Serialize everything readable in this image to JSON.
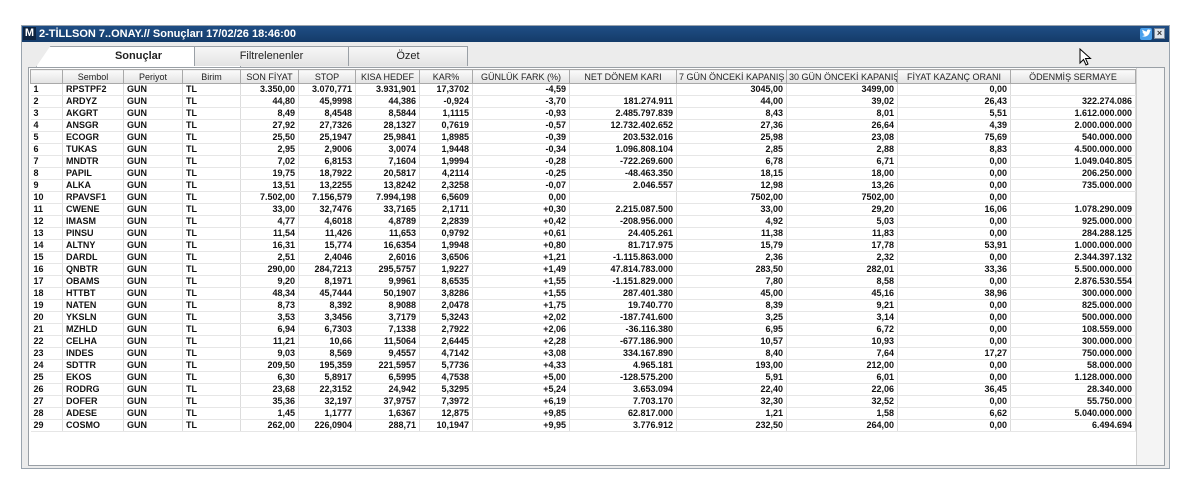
{
  "window": {
    "app_letter": "M",
    "title": "2-TİLLSON 7..ONAY.// Sonuçları  17/02/26 18:46:00"
  },
  "tabs": [
    {
      "label": "Sonuçlar"
    },
    {
      "label": "Filtrelenenler"
    },
    {
      "label": "Özet"
    }
  ],
  "icons": {
    "twitter": "twitter-icon",
    "close": "close-icon",
    "cursor": "mouse-cursor-icon"
  },
  "colors": {
    "titlebar": "#1f4e85",
    "twitter": "#4aa0ec"
  },
  "table": {
    "headers": [
      "",
      "Sembol",
      "Periyot",
      "Birim",
      "SON FİYAT",
      "STOP",
      "KISA HEDEF",
      "KAR%",
      "GÜNLÜK FARK (%)",
      "NET DÖNEM KARI",
      "7 GÜN ÖNCEKİ KAPANIŞ",
      "30 GÜN ÖNCEKİ KAPANIŞ",
      "FİYAT KAZANÇ ORANI",
      "ÖDENMİŞ SERMAYE"
    ],
    "rows": [
      [
        "1",
        "RPSTPF2",
        "GUN",
        "TL",
        "3.350,00",
        "3.070,771",
        "3.931,901",
        "17,3702",
        "-4,59",
        "",
        "3045,00",
        "3499,00",
        "0,00",
        ""
      ],
      [
        "2",
        "ARDYZ",
        "GUN",
        "TL",
        "44,80",
        "45,9998",
        "44,386",
        "-0,924",
        "-3,70",
        "181.274.911",
        "44,00",
        "39,02",
        "26,43",
        "322.274.086"
      ],
      [
        "3",
        "AKGRT",
        "GUN",
        "TL",
        "8,49",
        "8,4548",
        "8,5844",
        "1,1115",
        "-0,93",
        "2.485.797.839",
        "8,43",
        "8,01",
        "5,51",
        "1.612.000.000"
      ],
      [
        "4",
        "ANSGR",
        "GUN",
        "TL",
        "27,92",
        "27,7326",
        "28,1327",
        "0,7619",
        "-0,57",
        "12.732.402.652",
        "27,36",
        "26,64",
        "4,39",
        "2.000.000.000"
      ],
      [
        "5",
        "ECOGR",
        "GUN",
        "TL",
        "25,50",
        "25,1947",
        "25,9841",
        "1,8985",
        "-0,39",
        "203.532.016",
        "25,98",
        "23,08",
        "75,69",
        "540.000.000"
      ],
      [
        "6",
        "TUKAS",
        "GUN",
        "TL",
        "2,95",
        "2,9006",
        "3,0074",
        "1,9448",
        "-0,34",
        "1.096.808.104",
        "2,85",
        "2,88",
        "8,83",
        "4.500.000.000"
      ],
      [
        "7",
        "MNDTR",
        "GUN",
        "TL",
        "7,02",
        "6,8153",
        "7,1604",
        "1,9994",
        "-0,28",
        "-722.269.600",
        "6,78",
        "6,71",
        "0,00",
        "1.049.040.805"
      ],
      [
        "8",
        "PAPIL",
        "GUN",
        "TL",
        "19,75",
        "18,7922",
        "20,5817",
        "4,2114",
        "-0,25",
        "-48.463.350",
        "18,15",
        "18,00",
        "0,00",
        "206.250.000"
      ],
      [
        "9",
        "ALKA",
        "GUN",
        "TL",
        "13,51",
        "13,2255",
        "13,8242",
        "2,3258",
        "-0,07",
        "2.046.557",
        "12,98",
        "13,26",
        "0,00",
        "735.000.000"
      ],
      [
        "10",
        "RPAVSF1",
        "GUN",
        "TL",
        "7.502,00",
        "7.156,579",
        "7.994,198",
        "6,5609",
        "0,00",
        "",
        "7502,00",
        "7502,00",
        "0,00",
        ""
      ],
      [
        "11",
        "CWENE",
        "GUN",
        "TL",
        "33,00",
        "32,7476",
        "33,7165",
        "2,1711",
        "+0,30",
        "2.215.087.500",
        "33,00",
        "29,20",
        "16,06",
        "1.078.290.009"
      ],
      [
        "12",
        "IMASM",
        "GUN",
        "TL",
        "4,77",
        "4,6018",
        "4,8789",
        "2,2839",
        "+0,42",
        "-208.956.000",
        "4,92",
        "5,03",
        "0,00",
        "925.000.000"
      ],
      [
        "13",
        "PINSU",
        "GUN",
        "TL",
        "11,54",
        "11,426",
        "11,653",
        "0,9792",
        "+0,61",
        "24.405.261",
        "11,38",
        "11,83",
        "0,00",
        "284.288.125"
      ],
      [
        "14",
        "ALTNY",
        "GUN",
        "TL",
        "16,31",
        "15,774",
        "16,6354",
        "1,9948",
        "+0,80",
        "81.717.975",
        "15,79",
        "17,78",
        "53,91",
        "1.000.000.000"
      ],
      [
        "15",
        "DARDL",
        "GUN",
        "TL",
        "2,51",
        "2,4046",
        "2,6016",
        "3,6506",
        "+1,21",
        "-1.115.863.000",
        "2,36",
        "2,32",
        "0,00",
        "2.344.397.132"
      ],
      [
        "16",
        "QNBTR",
        "GUN",
        "TL",
        "290,00",
        "284,7213",
        "295,5757",
        "1,9227",
        "+1,49",
        "47.814.783.000",
        "283,50",
        "282,01",
        "33,36",
        "5.500.000.000"
      ],
      [
        "17",
        "OBAMS",
        "GUN",
        "TL",
        "9,20",
        "8,1971",
        "9,9961",
        "8,6535",
        "+1,55",
        "-1.151.829.000",
        "7,80",
        "8,58",
        "0,00",
        "2.876.530.554"
      ],
      [
        "18",
        "HTTBT",
        "GUN",
        "TL",
        "48,34",
        "45,7444",
        "50,1907",
        "3,8286",
        "+1,55",
        "287.401.380",
        "45,00",
        "45,16",
        "38,96",
        "300.000.000"
      ],
      [
        "19",
        "NATEN",
        "GUN",
        "TL",
        "8,73",
        "8,392",
        "8,9088",
        "2,0478",
        "+1,75",
        "19.740.770",
        "8,39",
        "9,21",
        "0,00",
        "825.000.000"
      ],
      [
        "20",
        "YKSLN",
        "GUN",
        "TL",
        "3,53",
        "3,3456",
        "3,7179",
        "5,3243",
        "+2,02",
        "-187.741.600",
        "3,25",
        "3,14",
        "0,00",
        "500.000.000"
      ],
      [
        "21",
        "MZHLD",
        "GUN",
        "TL",
        "6,94",
        "6,7303",
        "7,1338",
        "2,7922",
        "+2,06",
        "-36.116.380",
        "6,95",
        "6,72",
        "0,00",
        "108.559.000"
      ],
      [
        "22",
        "CELHA",
        "GUN",
        "TL",
        "11,21",
        "10,66",
        "11,5064",
        "2,6445",
        "+2,28",
        "-677.186.900",
        "10,57",
        "10,93",
        "0,00",
        "300.000.000"
      ],
      [
        "23",
        "INDES",
        "GUN",
        "TL",
        "9,03",
        "8,569",
        "9,4557",
        "4,7142",
        "+3,08",
        "334.167.890",
        "8,40",
        "7,64",
        "17,27",
        "750.000.000"
      ],
      [
        "24",
        "SDTTR",
        "GUN",
        "TL",
        "209,50",
        "195,359",
        "221,5957",
        "5,7736",
        "+4,33",
        "4.965.181",
        "193,00",
        "212,00",
        "0,00",
        "58.000.000"
      ],
      [
        "25",
        "EKOS",
        "GUN",
        "TL",
        "6,30",
        "5,8917",
        "6,5995",
        "4,7538",
        "+5,00",
        "-128.575.200",
        "5,91",
        "6,01",
        "0,00",
        "1.128.000.000"
      ],
      [
        "26",
        "RODRG",
        "GUN",
        "TL",
        "23,68",
        "22,3152",
        "24,942",
        "5,3295",
        "+5,24",
        "3.653.094",
        "22,40",
        "22,06",
        "36,45",
        "28.340.000"
      ],
      [
        "27",
        "DOFER",
        "GUN",
        "TL",
        "35,36",
        "32,197",
        "37,9757",
        "7,3972",
        "+6,19",
        "7.703.170",
        "32,30",
        "32,52",
        "0,00",
        "55.750.000"
      ],
      [
        "28",
        "ADESE",
        "GUN",
        "TL",
        "1,45",
        "1,1777",
        "1,6367",
        "12,875",
        "+9,85",
        "62.817.000",
        "1,21",
        "1,58",
        "6,62",
        "5.040.000.000"
      ],
      [
        "29",
        "COSMO",
        "GUN",
        "TL",
        "262,00",
        "226,0904",
        "288,71",
        "10,1947",
        "+9,95",
        "3.776.912",
        "232,50",
        "264,00",
        "0,00",
        "6.494.694"
      ]
    ]
  }
}
